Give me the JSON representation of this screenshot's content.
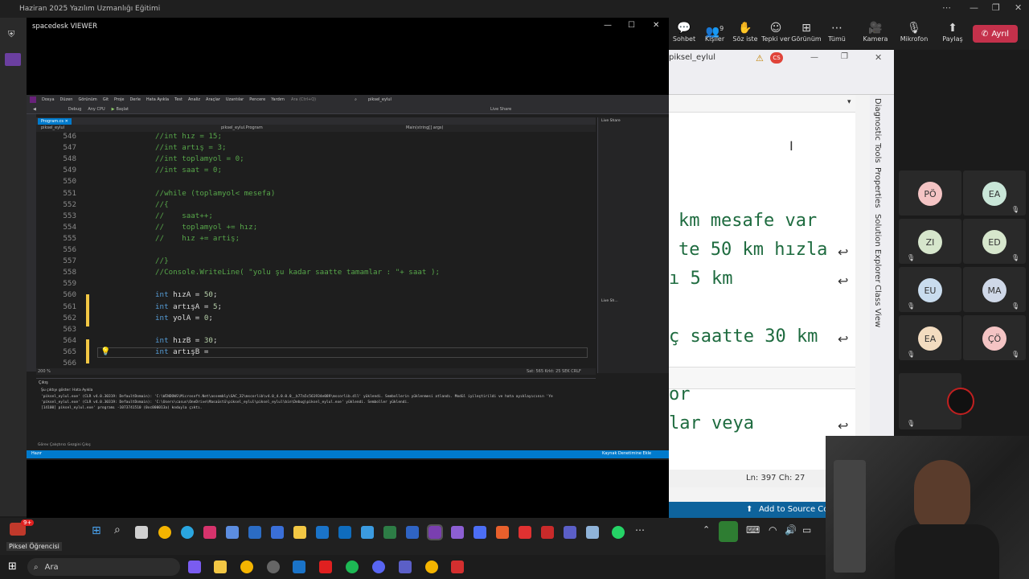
{
  "teams": {
    "title": "Haziran 2025 Yazılım Uzmanlığı Eğitimi",
    "toolbar": [
      {
        "icon": "chat-icon",
        "glyph": "💬",
        "label": "Sohbet"
      },
      {
        "icon": "people-icon",
        "glyph": "👥",
        "label": "Kişiler"
      },
      {
        "icon": "raise-hand-icon",
        "glyph": "✋",
        "label": "Söz iste"
      },
      {
        "icon": "react-icon",
        "glyph": "☺",
        "label": "Tepki ver"
      },
      {
        "icon": "view-icon",
        "glyph": "⊞",
        "label": "Görünüm"
      },
      {
        "icon": "more-icon",
        "glyph": "⋯",
        "label": "Tümü"
      },
      {
        "icon": "camera-icon",
        "glyph": "🎥",
        "label": "Kamera"
      },
      {
        "icon": "mic-icon",
        "glyph": "🎙",
        "label": "Mikrofon"
      },
      {
        "icon": "share-icon",
        "glyph": "⬆",
        "label": "Paylaş"
      }
    ],
    "people_count": "9",
    "leave_label": "Ayrıl",
    "participants": [
      {
        "initials": "PÖ",
        "color": "#f4c4c4",
        "muted": false
      },
      {
        "initials": "EA",
        "color": "#c9e6d8",
        "muted": true
      },
      {
        "initials": "ZI",
        "color": "#d6e6cc",
        "muted": true
      },
      {
        "initials": "ED",
        "color": "#d6e6cc",
        "muted": true
      },
      {
        "initials": "EU",
        "color": "#c9dcee",
        "muted": true
      },
      {
        "initials": "MA",
        "color": "#cfd8e8",
        "muted": true
      },
      {
        "initials": "EA",
        "color": "#f3dcc0",
        "muted": true
      },
      {
        "initials": "ÇÖ",
        "color": "#f4c4c4",
        "muted": true
      }
    ],
    "self_label": "Piksel Öğrencisi",
    "notif_count": "9+"
  },
  "spacedesk": {
    "title": "spacedesk VIEWER"
  },
  "vs": {
    "menu": [
      "Dosya",
      "Düzen",
      "Görünüm",
      "Git",
      "Proje",
      "Derle",
      "Hata Ayıkla",
      "Test",
      "Analiz",
      "Araçlar",
      "Uzantılar",
      "Pencere",
      "Yardım"
    ],
    "search_placeholder": "Ara (Ctrl+Q)",
    "solution": "piksel_eylul",
    "debug": "Debug",
    "cpu": "Any CPU",
    "start": "Başlat",
    "live_share": "Live Share",
    "tab": "Program.cs",
    "nav_left": "piksel_eylul",
    "nav_mid": "piksel_eylul.Program",
    "nav_right": "Main(string[] args)",
    "lines": [
      {
        "n": "546",
        "t": "//int hız = 15;",
        "cls": "cm"
      },
      {
        "n": "547",
        "t": "//int artış = 3;",
        "cls": "cm"
      },
      {
        "n": "548",
        "t": "//int toplamyol = 0;",
        "cls": "cm"
      },
      {
        "n": "549",
        "t": "//int saat = 0;",
        "cls": "cm"
      },
      {
        "n": "550",
        "t": "",
        "cls": ""
      },
      {
        "n": "551",
        "t": "//while (toplamyol< mesefa)",
        "cls": "cm"
      },
      {
        "n": "552",
        "t": "//{",
        "cls": "cm"
      },
      {
        "n": "553",
        "t": "//    saat++;",
        "cls": "cm"
      },
      {
        "n": "554",
        "t": "//    toplamyol += hız;",
        "cls": "cm"
      },
      {
        "n": "555",
        "t": "//    hız += artiş;",
        "cls": "cm"
      },
      {
        "n": "556",
        "t": "",
        "cls": ""
      },
      {
        "n": "557",
        "t": "//}",
        "cls": "cm"
      },
      {
        "n": "558",
        "t": "//Console.WriteLine( \"yolu şu kadar saatte tamamlar : \"+ saat );",
        "cls": "cm"
      },
      {
        "n": "559",
        "t": "",
        "cls": ""
      },
      {
        "n": "560",
        "kw": "int",
        "t": " hızA = ",
        "num": "50",
        "end": ";"
      },
      {
        "n": "561",
        "kw": "int",
        "t": " artışA = ",
        "num": "5",
        "end": ";"
      },
      {
        "n": "562",
        "kw": "int",
        "t": " yolA = ",
        "num": "0",
        "end": ";"
      },
      {
        "n": "563",
        "t": "",
        "cls": ""
      },
      {
        "n": "564",
        "kw": "int",
        "t": " hızB = ",
        "num": "30",
        "end": ";"
      },
      {
        "n": "565",
        "kw": "int",
        "t": " artışB = ",
        "num": "",
        "end": ""
      },
      {
        "n": "566",
        "t": "",
        "cls": ""
      }
    ],
    "zoom": "200 %",
    "cursor_info": "Sat: 565   Krkt: 25   SEK   CRLF",
    "right_panel_title": "Live Sh...",
    "output_title": "Çıkış",
    "output_source": "Şu çıktıyı göster:   Hata Ayıkla",
    "output_lines": [
      "'piksel_eylul.exe' (CLR v4.0.30319: DefaultDomain): 'C:\\WINDOWS\\Microsoft.Net\\assembly\\GAC_32\\mscorlib\\v4.0_4.0.0.0__b77a5c561934e089\\mscorlib.dll' yüklendi. Sembollerin yüklenmesi atlandı. Modül iyileştirildi ve hata ayıklayıcının 'Ye",
      "'piksel_eylul.exe' (CLR v4.0.30319: DefaultDomain): 'C:\\Users\\casus\\OneDrive\\Masaüstü\\piksel_eylul\\piksel_eylul\\bin\\Debug\\piksel_eylul.exe' yüklendi. Semboller yüklendi.",
      "[14100] piksel_eylul.exe' programı -1073741510 (0xc000013a) koduyla çıktı."
    ],
    "bottom_tabs": "Görev Çalıştırıcı Gezgini     Çıkış",
    "status_left": "Hazır",
    "status_right": "Kaynak Denetimine Ekle"
  },
  "right_vs": {
    "file_tab": "piksel_eylul",
    "big_lines": [
      "km mesafe var",
      "te 50 km hızla",
      "ı 5 km",
      "ç saatte 30 km",
      "or",
      "lar veya"
    ],
    "side_tabs": [
      "Diagnostic Tools",
      "Properties",
      "Solution Explorer",
      "Class View"
    ],
    "status": "Ln: 397    Ch: 27",
    "add_source": "Add to Source Co"
  },
  "taskbar": {
    "search": "Ara"
  }
}
